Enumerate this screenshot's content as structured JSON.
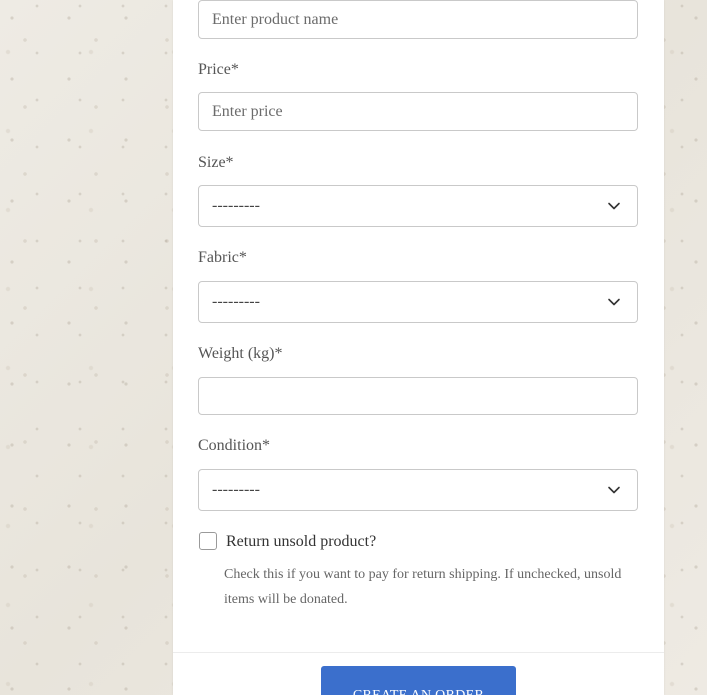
{
  "form": {
    "product_name": {
      "placeholder": "Enter product name",
      "value": ""
    },
    "price": {
      "label": "Price*",
      "placeholder": "Enter price",
      "value": ""
    },
    "size": {
      "label": "Size*",
      "selected": "---------"
    },
    "fabric": {
      "label": "Fabric*",
      "selected": "---------"
    },
    "weight": {
      "label": "Weight (kg)*",
      "value": ""
    },
    "condition": {
      "label": "Condition*",
      "selected": "---------"
    },
    "return_unsold": {
      "label": "Return unsold product?",
      "checked": false,
      "help": "Check this if you want to pay for return shipping. If unchecked, unsold items will be donated."
    }
  },
  "submit": {
    "label": "CREATE AN ORDER",
    "color": "#3b6fcc"
  },
  "icons": {
    "select_arrow": "chevron-down-icon"
  }
}
